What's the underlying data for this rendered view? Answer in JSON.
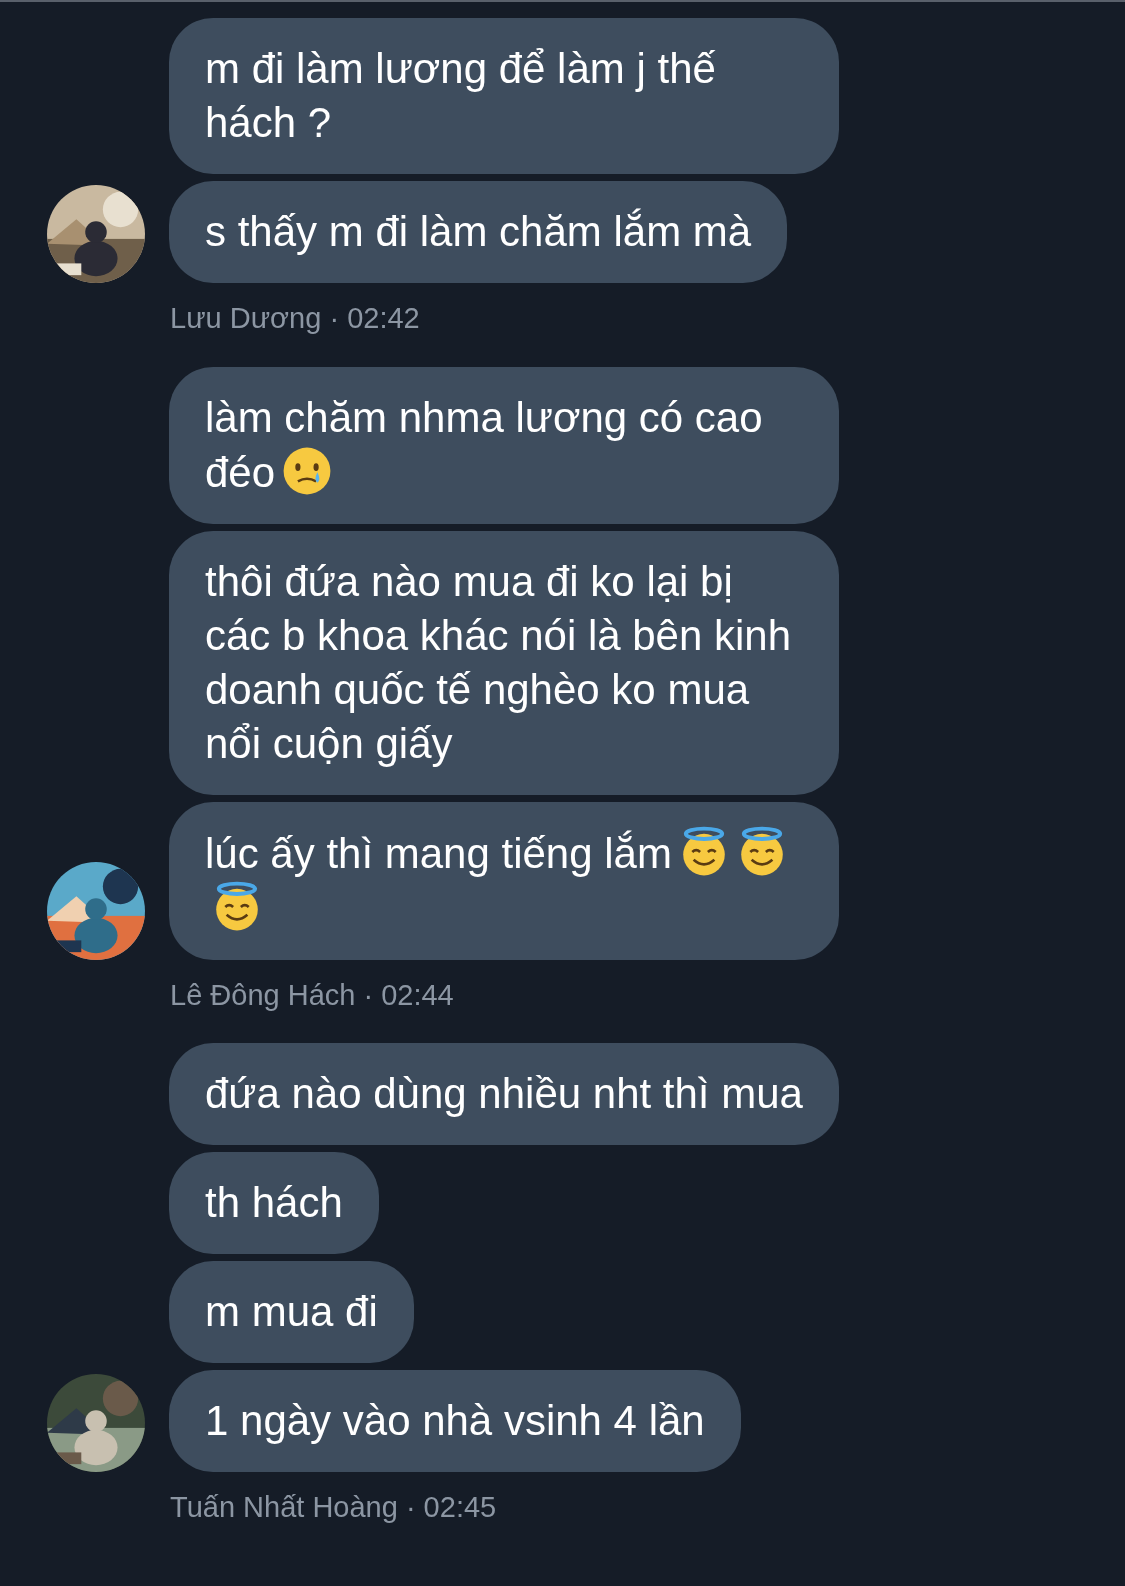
{
  "groups": [
    {
      "caption": "Lưu Dương · 02:42",
      "avatar": {
        "kind": "picture"
      },
      "messages": [
        {
          "text": "m đi làm lương để làm j thế hách ?"
        },
        {
          "text": "s thấy m đi làm chăm lắm mà"
        }
      ]
    },
    {
      "caption": "Lê Đông Hách · 02:44",
      "avatar": {
        "kind": "picture"
      },
      "messages": [
        {
          "text": "làm chăm nhma lương có cao đéo",
          "emojis": [
            {
              "kind": "tear"
            }
          ]
        },
        {
          "text": "thôi đứa nào mua đi ko lại bị các b khoa khác nói là bên kinh doanh quốc tế nghèo ko mua nổi cuộn giấy"
        },
        {
          "text": "lúc ấy thì mang tiếng lắm",
          "emojis": [
            {
              "kind": "halo"
            },
            {
              "kind": "halo"
            },
            {
              "kind": "halo"
            }
          ]
        }
      ]
    },
    {
      "caption": "Tuấn Nhất Hoàng · 02:45",
      "avatar": {
        "kind": "picture"
      },
      "messages": [
        {
          "text": "đứa nào dùng nhiều nht thì mua"
        },
        {
          "text": "th hách"
        },
        {
          "text": "m mua đi"
        },
        {
          "text": "1 ngày vào nhà vsinh 4 lần"
        }
      ]
    }
  ]
}
